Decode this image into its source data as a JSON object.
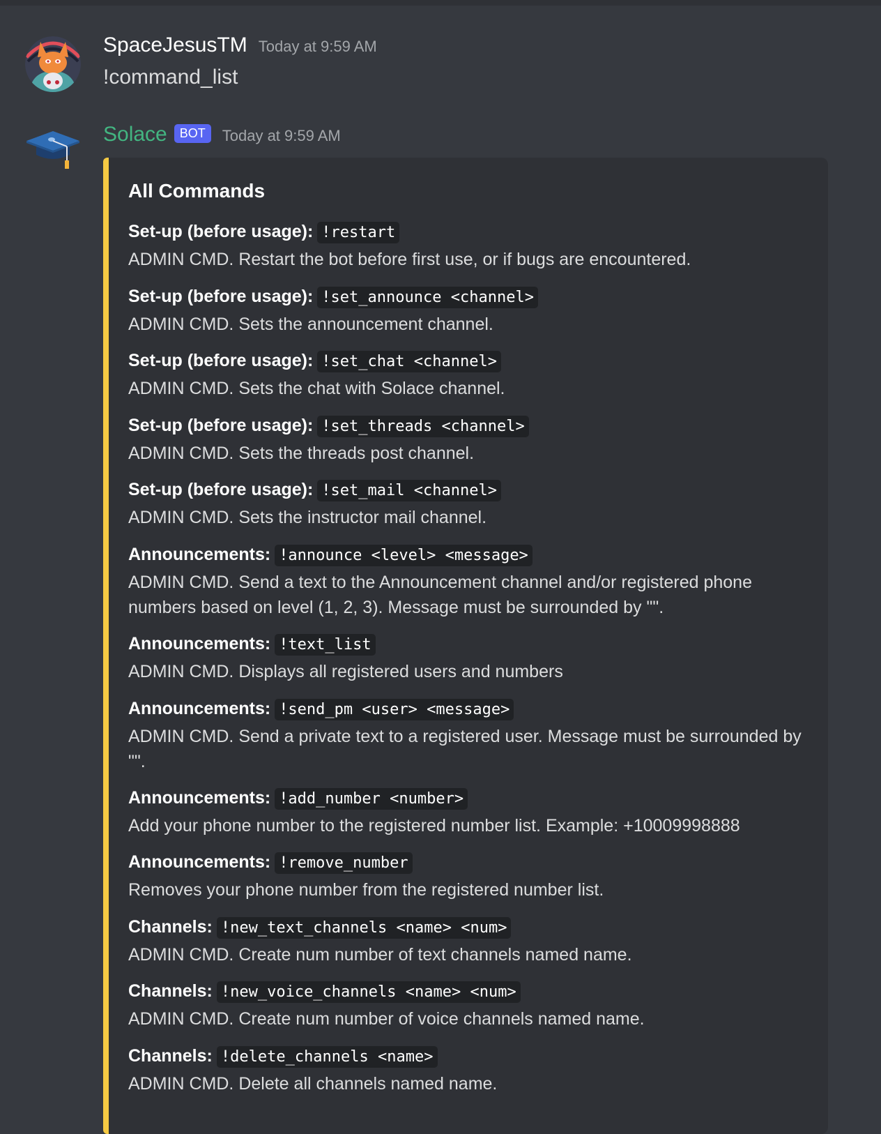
{
  "messages": [
    {
      "username": "SpaceJesusTM",
      "timestamp": "Today at 9:59 AM",
      "content": "!command_list"
    },
    {
      "username": "Solace",
      "bot_tag": "BOT",
      "timestamp": "Today at 9:59 AM",
      "embed": {
        "accent_color": "#f6ca43",
        "title": "All Commands",
        "fields": [
          {
            "name": "Set-up (before usage):",
            "command": "!restart",
            "value": "ADMIN CMD. Restart the bot before first use, or if bugs are encountered."
          },
          {
            "name": "Set-up (before usage):",
            "command": "!set_announce <channel>",
            "value": "ADMIN CMD. Sets the announcement channel."
          },
          {
            "name": "Set-up (before usage):",
            "command": "!set_chat <channel>",
            "value": "ADMIN CMD. Sets the chat with Solace channel."
          },
          {
            "name": "Set-up (before usage):",
            "command": "!set_threads <channel>",
            "value": "ADMIN CMD. Sets the threads post channel."
          },
          {
            "name": "Set-up (before usage):",
            "command": "!set_mail <channel>",
            "value": "ADMIN CMD. Sets the instructor mail channel."
          },
          {
            "name": "Announcements:",
            "command": "!announce <level> <message>",
            "value": "ADMIN CMD. Send a text to the Announcement channel and/or registered phone numbers based on level (1, 2, 3). Message must be surrounded by \"\"."
          },
          {
            "name": "Announcements:",
            "command": "!text_list",
            "value": "ADMIN CMD. Displays all registered users and numbers"
          },
          {
            "name": "Announcements:",
            "command": "!send_pm <user> <message>",
            "value": "ADMIN CMD. Send a private text to a registered user. Message must be surrounded by \"\"."
          },
          {
            "name": "Announcements:",
            "command": "!add_number <number>",
            "value": "Add your phone number to the registered number list. Example: +10009998888"
          },
          {
            "name": "Announcements:",
            "command": "!remove_number",
            "value": "Removes your phone number from the registered number list."
          },
          {
            "name": "Channels:",
            "command": "!new_text_channels <name> <num>",
            "value": "ADMIN CMD. Create num number of text channels named name."
          },
          {
            "name": "Channels:",
            "command": "!new_voice_channels <name> <num>",
            "value": "ADMIN CMD. Create num number of voice channels named name."
          },
          {
            "name": "Channels:",
            "command": "!delete_channels <name>",
            "value": "ADMIN CMD. Delete all channels named name."
          }
        ]
      }
    }
  ]
}
